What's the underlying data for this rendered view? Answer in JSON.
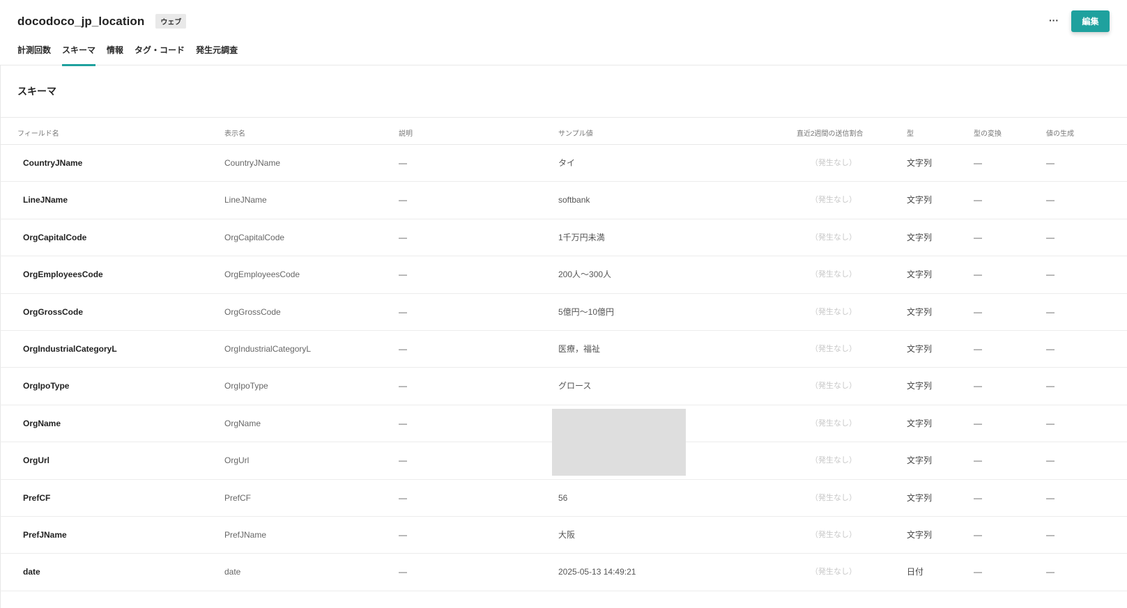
{
  "header": {
    "title": "docodoco_jp_location",
    "badge": "ウェブ",
    "more_label": "···",
    "edit_label": "編集"
  },
  "tabs": [
    {
      "label": "計測回数",
      "active": false
    },
    {
      "label": "スキーマ",
      "active": true
    },
    {
      "label": "情報",
      "active": false
    },
    {
      "label": "タグ・コード",
      "active": false
    },
    {
      "label": "発生元調査",
      "active": false
    }
  ],
  "section": {
    "title": "スキーマ"
  },
  "table": {
    "columns": [
      "フィールド名",
      "表示名",
      "説明",
      "サンプル値",
      "直近2週間の送信割合",
      "型",
      "型の変換",
      "値の生成"
    ],
    "rows": [
      {
        "field": "CountryJName",
        "display": "CountryJName",
        "desc": "—",
        "sample": "タイ",
        "ratio": "（発生なし）",
        "type": "文字列",
        "conv": "—",
        "gen": "—"
      },
      {
        "field": "LineJName",
        "display": "LineJName",
        "desc": "—",
        "sample": "softbank",
        "ratio": "（発生なし）",
        "type": "文字列",
        "conv": "—",
        "gen": "—"
      },
      {
        "field": "OrgCapitalCode",
        "display": "OrgCapitalCode",
        "desc": "—",
        "sample": "1千万円未満",
        "ratio": "（発生なし）",
        "type": "文字列",
        "conv": "—",
        "gen": "—"
      },
      {
        "field": "OrgEmployeesCode",
        "display": "OrgEmployeesCode",
        "desc": "—",
        "sample": "200人〜300人",
        "ratio": "（発生なし）",
        "type": "文字列",
        "conv": "—",
        "gen": "—"
      },
      {
        "field": "OrgGrossCode",
        "display": "OrgGrossCode",
        "desc": "—",
        "sample": "5億円〜10億円",
        "ratio": "（発生なし）",
        "type": "文字列",
        "conv": "—",
        "gen": "—"
      },
      {
        "field": "OrgIndustrialCategoryL",
        "display": "OrgIndustrialCategoryL",
        "desc": "—",
        "sample": "医療，福祉",
        "ratio": "（発生なし）",
        "type": "文字列",
        "conv": "—",
        "gen": "—"
      },
      {
        "field": "OrgIpoType",
        "display": "OrgIpoType",
        "desc": "—",
        "sample": "グロース",
        "ratio": "（発生なし）",
        "type": "文字列",
        "conv": "—",
        "gen": "—"
      },
      {
        "field": "OrgName",
        "display": "OrgName",
        "desc": "—",
        "sample": "",
        "ratio": "（発生なし）",
        "type": "文字列",
        "conv": "—",
        "gen": "—"
      },
      {
        "field": "OrgUrl",
        "display": "OrgUrl",
        "desc": "—",
        "sample": "",
        "ratio": "（発生なし）",
        "type": "文字列",
        "conv": "—",
        "gen": "—"
      },
      {
        "field": "PrefCF",
        "display": "PrefCF",
        "desc": "—",
        "sample": "56",
        "ratio": "（発生なし）",
        "type": "文字列",
        "conv": "—",
        "gen": "—"
      },
      {
        "field": "PrefJName",
        "display": "PrefJName",
        "desc": "—",
        "sample": "大阪",
        "ratio": "（発生なし）",
        "type": "文字列",
        "conv": "—",
        "gen": "—"
      },
      {
        "field": "date",
        "display": "date",
        "desc": "—",
        "sample": "2025-05-13 14:49:21",
        "ratio": "（発生なし）",
        "type": "日付",
        "conv": "—",
        "gen": "—"
      }
    ]
  }
}
